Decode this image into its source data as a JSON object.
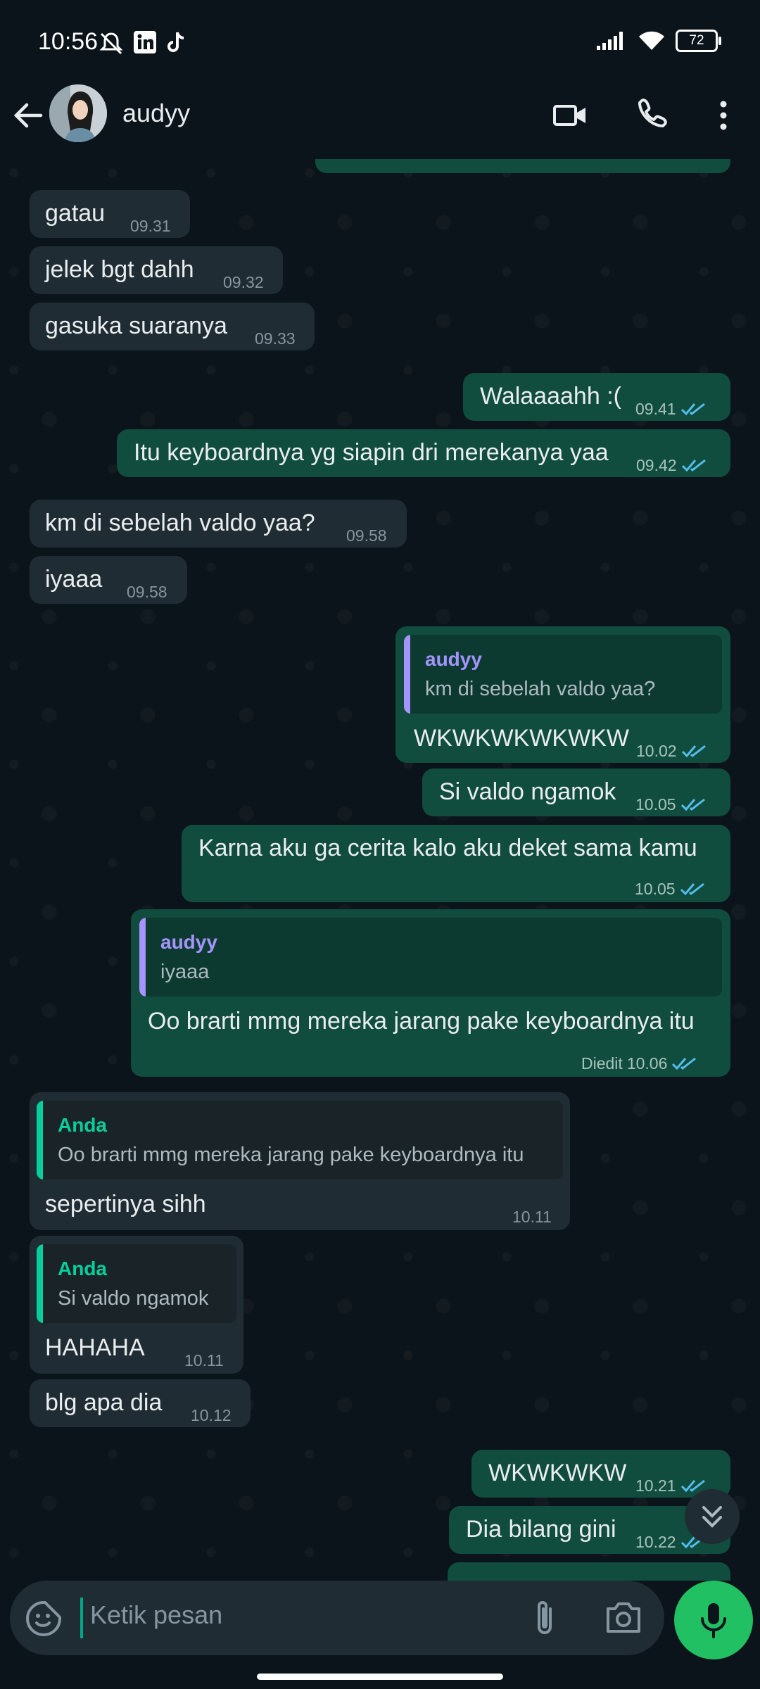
{
  "status_bar": {
    "time": "10:56",
    "battery": "72"
  },
  "header": {
    "contact_name": "audyy"
  },
  "messages": [
    {
      "text": "gatau",
      "time": "09.31"
    },
    {
      "text": "jelek bgt dahh",
      "time": "09.32"
    },
    {
      "text": "gasuka suaranya",
      "time": "09.33"
    },
    {
      "text": "Walaaaahh :(",
      "time": "09.41"
    },
    {
      "text": "Itu keyboardnya yg siapin dri merekanya yaa",
      "time": "09.42"
    },
    {
      "text": "km di sebelah valdo yaa?",
      "time": "09.58"
    },
    {
      "text": "iyaaa",
      "time": "09.58"
    },
    {
      "text": "WKWKWKWKWKW",
      "time": "10.02",
      "quote_name": "audyy",
      "quote_text": "km di sebelah valdo yaa?"
    },
    {
      "text": "Si valdo ngamok",
      "time": "10.05"
    },
    {
      "text": "Karna aku ga cerita kalo aku deket sama kamu",
      "time": "10.05"
    },
    {
      "text": "Oo brarti mmg mereka jarang pake keyboardnya itu",
      "time": "10.06",
      "edited": "Diedit",
      "quote_name": "audyy",
      "quote_text": "iyaaa"
    },
    {
      "text": "sepertinya sihh",
      "time": "10.11",
      "quote_name": "Anda",
      "quote_text": "Oo brarti mmg mereka jarang pake keyboardnya itu"
    },
    {
      "text": "HAHAHA",
      "time": "10.11",
      "quote_name": "Anda",
      "quote_text": "Si valdo ngamok"
    },
    {
      "text": "blg apa dia",
      "time": "10.12"
    },
    {
      "text": "WKWKWKW",
      "time": "10.21"
    },
    {
      "text": "Dia bilang gini",
      "time": "10.22"
    }
  ],
  "composer": {
    "placeholder": "Ketik pesan"
  },
  "colors": {
    "incoming": "#202c33",
    "outgoing": "#114d3e",
    "accent": "#21c063",
    "read_ticks": "#53bdeb",
    "quote_self": "#06cf9c",
    "quote_other": "#a594ff"
  }
}
